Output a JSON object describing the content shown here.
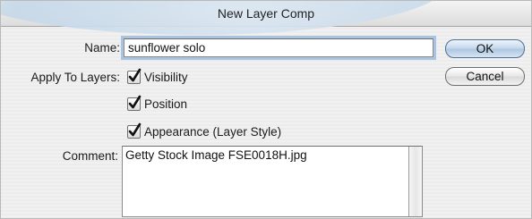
{
  "window": {
    "title": "New Layer Comp"
  },
  "form": {
    "name_label": "Name:",
    "name_value": "sunflower solo",
    "apply_label": "Apply To Layers:",
    "options": [
      {
        "label": "Visibility",
        "checked": true
      },
      {
        "label": "Position",
        "checked": true
      },
      {
        "label": "Appearance (Layer Style)",
        "checked": true
      }
    ],
    "comment_label": "Comment:",
    "comment_value": "Getty Stock Image FSE0018H.jpg"
  },
  "buttons": {
    "ok_label": "OK",
    "cancel_label": "Cancel"
  },
  "icons": {
    "checkbox_mark": "checkmark-icon"
  }
}
